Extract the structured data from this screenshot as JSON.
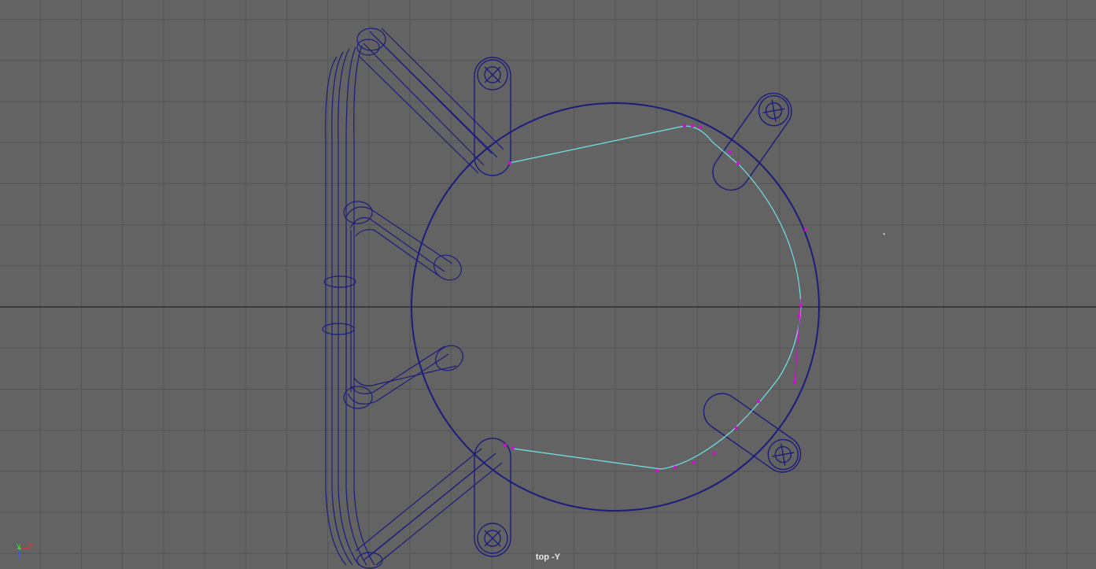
{
  "viewport": {
    "camera_label": "top -Y",
    "background_color": "#636363",
    "grid_color": "#555555",
    "axis_line_color": "#2f2f2f",
    "wireframe_color": "#1c1c7c",
    "curve_color": "#6fe3e8",
    "cv_color": "#d010d0"
  },
  "axis_gizmo": {
    "y_label": "y",
    "x_label": "x",
    "z_label": "z",
    "y_color": "#2ee82e",
    "x_color": "#e83030",
    "z_color": "#3060ff"
  }
}
